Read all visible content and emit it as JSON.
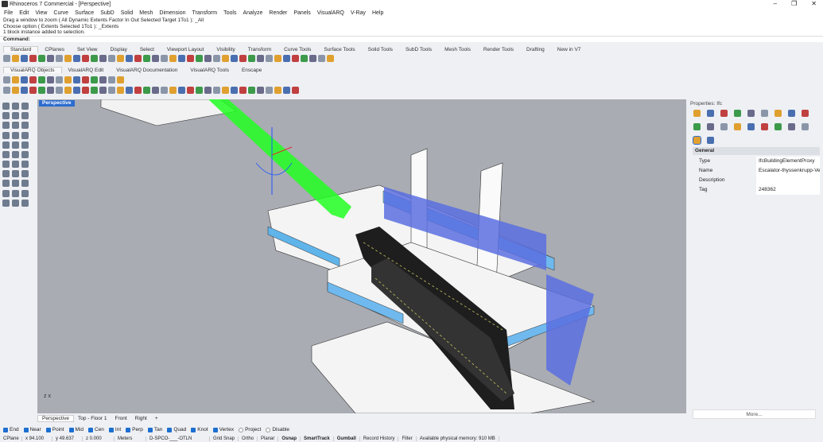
{
  "title": "Rhinoceros 7 Commercial - [Perspective]",
  "menu": [
    "File",
    "Edit",
    "View",
    "Curve",
    "Surface",
    "SubD",
    "Solid",
    "Mesh",
    "Dimension",
    "Transform",
    "Tools",
    "Analyze",
    "Render",
    "Panels",
    "VisualARQ",
    "V-Ray",
    "Help"
  ],
  "history": [
    "Drag a window to zoom ( All  Dynamic  Extents  Factor  In  Out  Selected  Target  1To1 ): _All",
    "Choose option ( Extents  Selected  1To1 ): _Extents",
    "1 block instance added to selection."
  ],
  "command_label": "Command:",
  "tabs1": [
    "Standard",
    "CPlanes",
    "Set View",
    "Display",
    "Select",
    "Viewport Layout",
    "Visibility",
    "Transform",
    "Curve Tools",
    "Surface Tools",
    "Solid Tools",
    "SubD Tools",
    "Mesh Tools",
    "Render Tools",
    "Drafting",
    "New in V7"
  ],
  "tabs2": [
    "VisualARQ Objects",
    "VisualARQ Edit",
    "VisualARQ Documentation",
    "VisualARQ Tools",
    "Enscape"
  ],
  "viewport_label": "Perspective",
  "viewport_tabs": [
    "Perspective",
    "Top - Floor 1",
    "Front",
    "Right",
    "+"
  ],
  "osnaps": [
    {
      "label": "End",
      "on": true
    },
    {
      "label": "Near",
      "on": true
    },
    {
      "label": "Point",
      "on": true
    },
    {
      "label": "Mid",
      "on": true
    },
    {
      "label": "Cen",
      "on": true
    },
    {
      "label": "Int",
      "on": true
    },
    {
      "label": "Perp",
      "on": true
    },
    {
      "label": "Tan",
      "on": true
    },
    {
      "label": "Quad",
      "on": true
    },
    {
      "label": "Knot",
      "on": true
    },
    {
      "label": "Vertex",
      "on": true
    },
    {
      "label": "Project",
      "on": false
    },
    {
      "label": "Disable",
      "on": false
    }
  ],
  "status": {
    "cplane": "CPlane",
    "x": "x 94.100",
    "y": "y 49.637",
    "z": "z 0.000",
    "units": "Meters",
    "layer": "D-SPCO-___-OTLN",
    "grid_snap": "Grid Snap",
    "ortho": "Ortho",
    "planar": "Planar",
    "osnap": "Osnap",
    "smarttrack": "SmartTrack",
    "gumball": "Gumball",
    "record_history": "Record History",
    "filter": "Filter",
    "memory": "Available physical memory: 910 MB"
  },
  "properties": {
    "header": "Properties: Ifc",
    "section": "General",
    "rows": [
      {
        "key": "Type",
        "value": "IfcBuildingElementProxy"
      },
      {
        "key": "Name",
        "value": "Escalator-thyssenkrupp-Velino"
      },
      {
        "key": "Description",
        "value": ""
      },
      {
        "key": "Tag",
        "value": "248362"
      }
    ],
    "more": "More..."
  },
  "colors": {
    "accent": "#2c6ccf",
    "viewport_bg": "#a9acb2",
    "selection": "#22ff22",
    "glass": "#5a6fe0"
  }
}
